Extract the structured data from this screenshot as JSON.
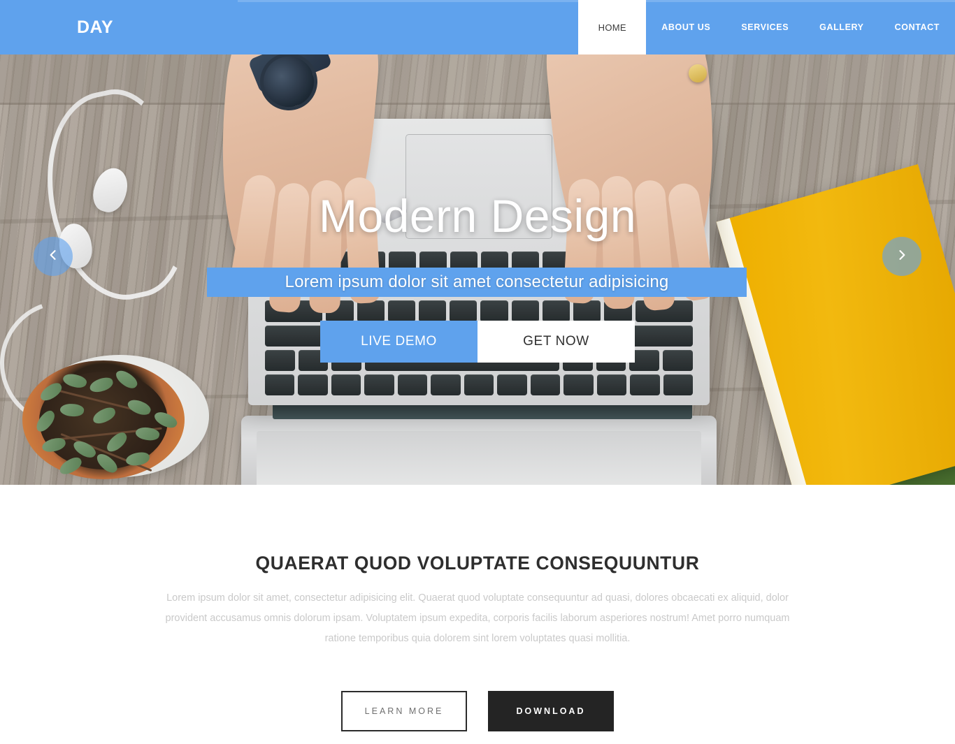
{
  "brand": {
    "name": "DAY"
  },
  "nav": {
    "items": [
      {
        "label": "HOME",
        "active": true
      },
      {
        "label": "ABOUT US",
        "active": false
      },
      {
        "label": "SERVICES",
        "active": false
      },
      {
        "label": "GALLERY",
        "active": false
      },
      {
        "label": "CONTACT",
        "active": false
      }
    ]
  },
  "hero": {
    "title": "Modern Design",
    "subtitle": "Lorem ipsum dolor sit amet consectetur adipisicing",
    "primary_button": "LIVE DEMO",
    "secondary_button": "GET NOW",
    "prev_icon": "chevron-left-icon",
    "next_icon": "chevron-right-icon",
    "background_description": "Overhead photo of hands typing on a white laptop on a grey wooden desk, white earbuds at left, potted green plant bottom-left, yellow hardcover book at right"
  },
  "intro": {
    "heading": "QUAERAT QUOD VOLUPTATE CONSEQUUNTUR",
    "paragraph": "Lorem ipsum dolor sit amet, consectetur adipisicing elit. Quaerat quod voluptate consequuntur ad quasi, dolores obcaecati ex aliquid, dolor provident accusamus omnis dolorum ipsam. Voluptatem ipsum expedita, corporis facilis laborum asperiores nostrum! Amet porro numquam ratione temporibus quia dolorem sint lorem voluptates quasi mollitia.",
    "learn_more_button": "LEARN MORE",
    "download_button": "DOWNLOAD"
  },
  "colors": {
    "accent_blue": "#5fa2ed",
    "dark": "#242424",
    "heading": "#2e2e2e",
    "body_text": "#c9c9c9",
    "book_yellow": "#f3b200",
    "book_green": "#4b7230"
  }
}
